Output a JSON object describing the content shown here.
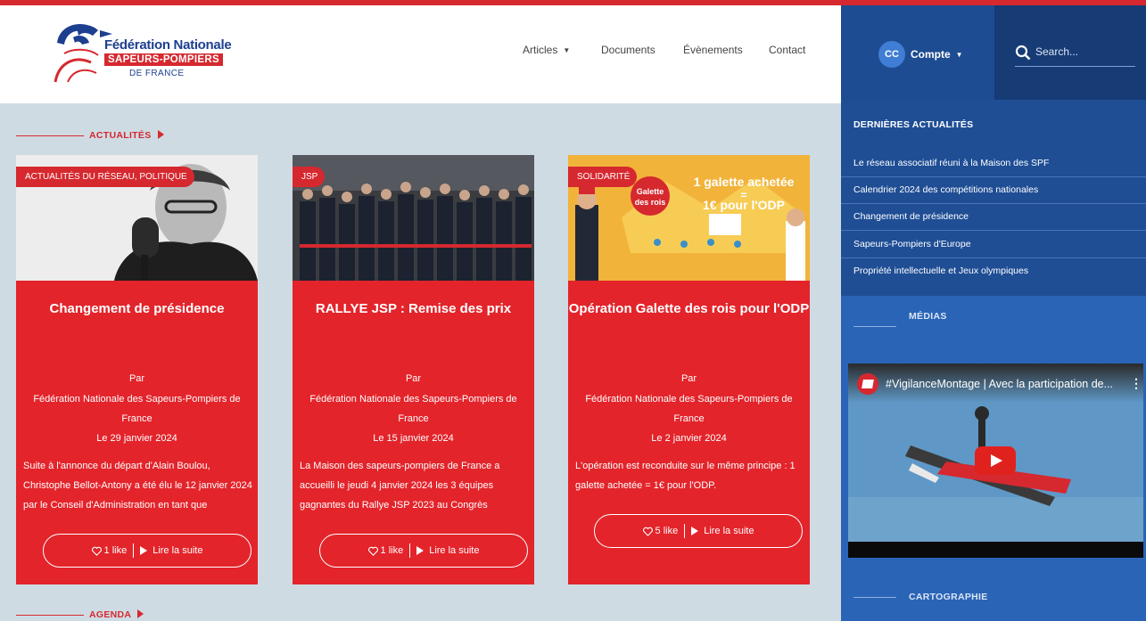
{
  "brand": {
    "line1": "Fédération Nationale",
    "line2": "SAPEURS-POMPIERS",
    "line3": "DE FRANCE"
  },
  "nav": {
    "articles": "Articles",
    "documents": "Documents",
    "evenements": "Évènements",
    "contact": "Contact"
  },
  "account": {
    "initials": "CC",
    "label": "Compte"
  },
  "search": {
    "placeholder": "Search..."
  },
  "sections": {
    "actualites": "ACTUALITÉS",
    "agenda": "AGENDA"
  },
  "cards": [
    {
      "category": "ACTUALITÉS DU RÉSEAU, POLITIQUE",
      "title": "Changement de présidence",
      "by": "Par",
      "author_line1": "Fédération Nationale des Sapeurs-Pompiers de",
      "author_line2": "France",
      "date": "Le 29 janvier 2024",
      "excerpt": "Suite à l'annonce du départ d'Alain Boulou, Christophe Bellot-Antony a été élu le 12 janvier 2024 par le Conseil d'Administration en tant que",
      "likes": "1 like",
      "read_more": "Lire la suite"
    },
    {
      "category": "JSP",
      "title": "RALLYE JSP : Remise des prix",
      "by": "Par",
      "author_line1": "Fédération Nationale des Sapeurs-Pompiers de",
      "author_line2": "France",
      "date": "Le 15 janvier 2024",
      "excerpt": "La Maison des sapeurs-pompiers de France a accueilli le jeudi 4 janvier 2024 les 3 équipes gagnantes du Rallye JSP 2023 au Congrès",
      "likes": "1 like",
      "read_more": "Lire la suite"
    },
    {
      "category": "SOLIDARITÉ",
      "title": "Opération Galette des rois pour l'ODP",
      "by": "Par",
      "author_line1": "Fédération Nationale des Sapeurs-Pompiers de",
      "author_line2": "France",
      "date": "Le 2 janvier 2024",
      "excerpt": "L'opération est reconduite sur le même principe : 1 galette achetée = 1€ pour l'ODP.",
      "likes": "5 like",
      "read_more": "Lire la suite",
      "promo_line1": "1 galette achetée",
      "promo_line2": "=",
      "promo_line3": "1€ pour l'ODP",
      "promo_badge_line1": "Galette",
      "promo_badge_line2": "des rois"
    }
  ],
  "sidebar": {
    "latest_title": "DERNIÈRES ACTUALITÉS",
    "latest": [
      "Le réseau associatif réuni à la Maison des SPF",
      "Calendrier 2024 des compétitions nationales",
      "Changement de présidence",
      "Sapeurs-Pompiers d'Europe",
      "Propriété intellectuelle et Jeux olympiques"
    ],
    "medias_title": "MÉDIAS",
    "video_title": "#VigilanceMontage | Avec la participation de...",
    "cartographie_title": "CARTOGRAPHIE"
  },
  "colors": {
    "brand_red": "#d6282f",
    "card_red": "#e3242b",
    "brand_blue": "#1d3f8f",
    "sidebar_blue": "#2a64b6",
    "sidebar_dark": "#1f4e95",
    "page_bg": "#cfdbe3"
  },
  "icons": {
    "logo": "federation-logo-icon",
    "search": "search-icon",
    "like": "heart-icon",
    "read": "play-icon",
    "dropdown": "caret-down-icon",
    "video_play": "youtube-play-icon"
  }
}
